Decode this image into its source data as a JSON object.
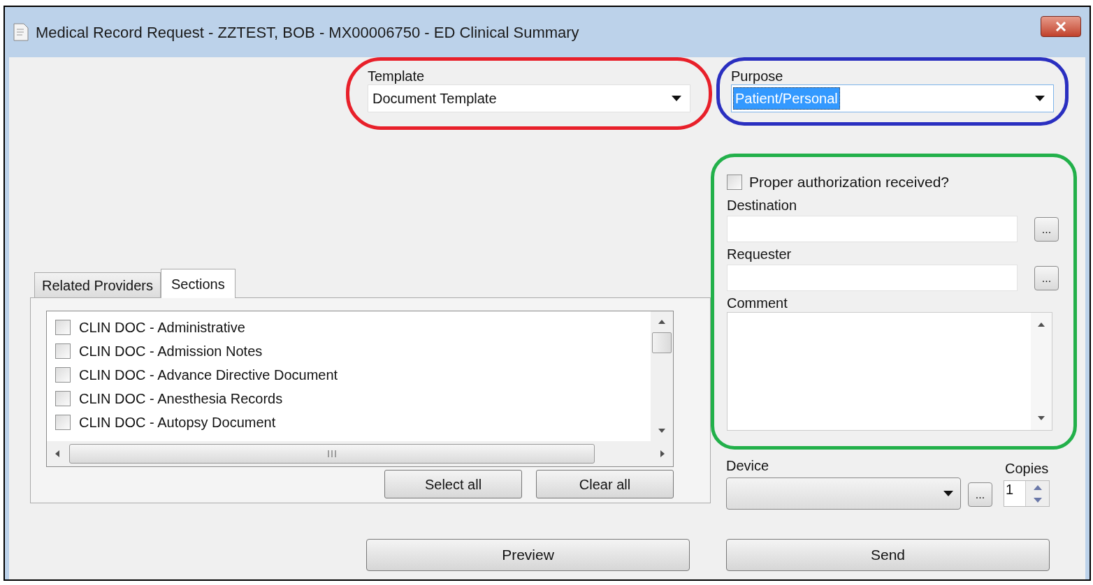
{
  "window": {
    "title": "Medical Record Request - ZZTEST, BOB - MX00006750 - ED Clinical Summary"
  },
  "template": {
    "label": "Template",
    "value": "Document Template",
    "color": "#e8202a"
  },
  "purpose": {
    "label": "Purpose",
    "value": "Patient/Personal",
    "value_selected": true,
    "color": "#2a2fc0"
  },
  "authorization": {
    "color": "#22b04a",
    "checkbox": {
      "label": "Proper authorization received?",
      "checked": false
    },
    "fields": [
      {
        "label": "Destination",
        "browse": "..."
      },
      {
        "label": "Requester",
        "browse": "..."
      }
    ],
    "comment": {
      "label": "Comment"
    }
  },
  "device": {
    "label": "Device",
    "browse": "..."
  },
  "copies": {
    "label": "Copies",
    "value": "1"
  },
  "tabs": [
    {
      "label": "Related Providers",
      "selected": false
    },
    {
      "label": "Sections",
      "selected": true
    }
  ],
  "sections": [
    {
      "label": "CLIN DOC - Administrative",
      "checked": false
    },
    {
      "label": "CLIN DOC - Admission Notes",
      "checked": false
    },
    {
      "label": "CLIN DOC - Advance Directive Document",
      "checked": false
    },
    {
      "label": "CLIN DOC - Anesthesia Records",
      "checked": false
    },
    {
      "label": "CLIN DOC - Autopsy Document",
      "checked": false
    }
  ],
  "list_buttons": [
    "Select all",
    "Clear all"
  ],
  "buttons": [
    "Preview",
    "Send"
  ]
}
